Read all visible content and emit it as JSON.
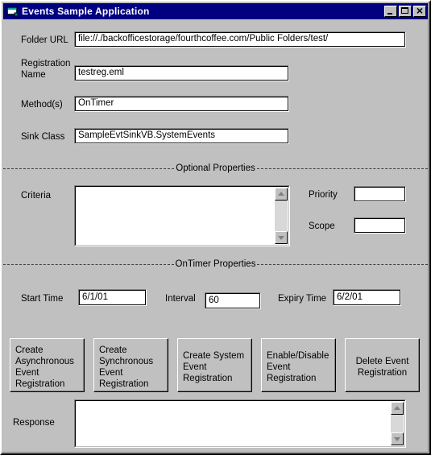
{
  "window": {
    "title": "Events Sample Application",
    "icon": "vb-form-icon",
    "titlebar_color": "#000080",
    "face_color": "#c0c0c0",
    "caption_buttons": [
      {
        "name": "minimize-button",
        "glyph": "_"
      },
      {
        "name": "maximize-button",
        "glyph": "□"
      },
      {
        "name": "close-button",
        "glyph": "✕"
      }
    ]
  },
  "fields": {
    "folder_url": {
      "label": "Folder URL",
      "value": "file://./backofficestorage/fourthcoffee.com/Public Folders/test/"
    },
    "registration_name": {
      "label": "Registration\nName",
      "value": "testreg.eml"
    },
    "methods": {
      "label": "Method(s)",
      "value": "OnTimer"
    },
    "sink_class": {
      "label": "Sink Class",
      "value": "SampleEvtSinkVB.SystemEvents"
    }
  },
  "optional_properties": {
    "section_label": "Optional Properties",
    "criteria": {
      "label": "Criteria",
      "value": ""
    },
    "priority": {
      "label": "Priority",
      "value": ""
    },
    "scope": {
      "label": "Scope",
      "value": ""
    }
  },
  "ontimer_properties": {
    "section_label": "OnTimer Properties",
    "start_time": {
      "label": "Start Time",
      "value": "6/1/01"
    },
    "interval": {
      "label": "Interval",
      "value": "60"
    },
    "expiry_time": {
      "label": "Expiry Time",
      "value": "6/2/01"
    }
  },
  "buttons": [
    {
      "name": "create-asynchronous-event-registration-button",
      "label": "Create\nAsynchronous\nEvent\nRegistration"
    },
    {
      "name": "create-synchronous-event-registration-button",
      "label": "Create\nSynchronous\nEvent\nRegistration"
    },
    {
      "name": "create-system-event-registration-button",
      "label": "Create System\nEvent\nRegistration"
    },
    {
      "name": "enable-disable-event-registration-button",
      "label": "Enable/Disable\nEvent\nRegistration"
    },
    {
      "name": "delete-event-registration-button",
      "label": "Delete Event\nRegistration"
    }
  ],
  "response": {
    "label": "Response",
    "value": ""
  }
}
